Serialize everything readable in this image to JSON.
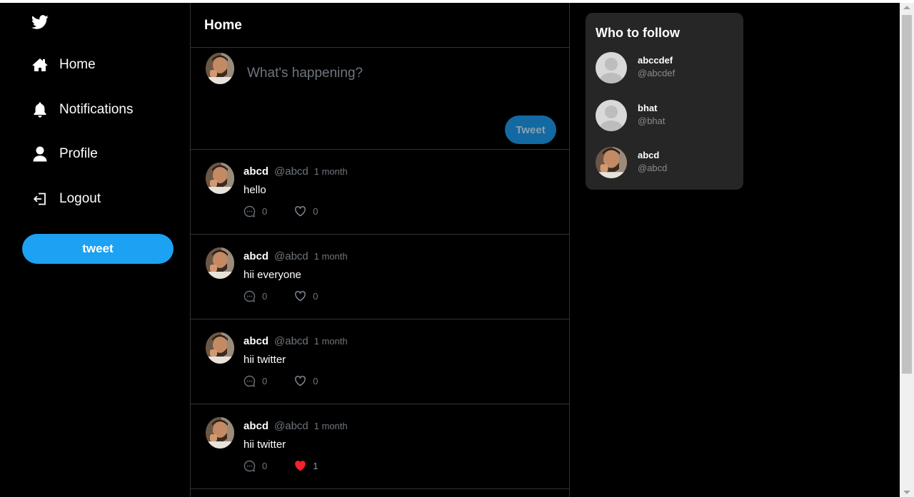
{
  "theme": {
    "background": "#000000",
    "accent": "#1da1f2",
    "panel": "#262626",
    "muted": "#6e767d",
    "like_red": "#f4212e"
  },
  "sidebar": {
    "logo_icon": "twitter-bird-icon",
    "items": [
      {
        "label": "Home",
        "icon": "home-icon"
      },
      {
        "label": "Notifications",
        "icon": "bell-icon"
      },
      {
        "label": "Profile",
        "icon": "user-icon"
      },
      {
        "label": "Logout",
        "icon": "logout-icon"
      }
    ],
    "tweet_button": "tweet"
  },
  "feed": {
    "title": "Home",
    "composer": {
      "placeholder": "What's happening?",
      "button": "Tweet"
    },
    "posts": [
      {
        "name": "abcd",
        "handle": "@abcd",
        "time": "1 month",
        "text": "hello",
        "comments": "0",
        "likes": "0",
        "liked": false
      },
      {
        "name": "abcd",
        "handle": "@abcd",
        "time": "1 month",
        "text": "hii everyone",
        "comments": "0",
        "likes": "0",
        "liked": false
      },
      {
        "name": "abcd",
        "handle": "@abcd",
        "time": "1 month",
        "text": "hii twitter",
        "comments": "0",
        "likes": "0",
        "liked": false
      },
      {
        "name": "abcd",
        "handle": "@abcd",
        "time": "1 month",
        "text": "hii twitter",
        "comments": "0",
        "likes": "1",
        "liked": true
      }
    ]
  },
  "who_to_follow": {
    "title": "Who to follow",
    "users": [
      {
        "name": "abccdef",
        "handle": "@abcdef",
        "avatar": "default-avatar"
      },
      {
        "name": "bhat",
        "handle": "@bhat",
        "avatar": "default-avatar"
      },
      {
        "name": "abcd",
        "handle": "@abcd",
        "avatar": "photo-avatar"
      }
    ]
  }
}
